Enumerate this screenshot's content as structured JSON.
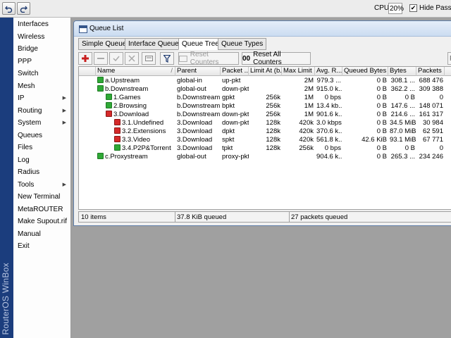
{
  "topbar": {
    "undo_icon": "undo-icon",
    "redo_icon": "redo-icon",
    "cpu_label": "CPU:",
    "cpu_value": "20%",
    "hide_passwords_checked": true,
    "hide_passwords_mark": "✔",
    "hide_passwords_label": "Hide Passwords"
  },
  "brand": {
    "text": "RouterOS WinBox"
  },
  "menu": {
    "items": [
      {
        "label": "Interfaces",
        "submenu": false
      },
      {
        "label": "Wireless",
        "submenu": false
      },
      {
        "label": "Bridge",
        "submenu": false
      },
      {
        "label": "PPP",
        "submenu": false
      },
      {
        "label": "Switch",
        "submenu": false
      },
      {
        "label": "Mesh",
        "submenu": false
      },
      {
        "label": "IP",
        "submenu": true
      },
      {
        "label": "Routing",
        "submenu": true
      },
      {
        "label": "System",
        "submenu": true
      },
      {
        "label": "Queues",
        "submenu": false
      },
      {
        "label": "Files",
        "submenu": false
      },
      {
        "label": "Log",
        "submenu": false
      },
      {
        "label": "Radius",
        "submenu": false
      },
      {
        "label": "Tools",
        "submenu": true
      },
      {
        "label": "New Terminal",
        "submenu": false
      },
      {
        "label": "MetaROUTER",
        "submenu": false
      },
      {
        "label": "Make Supout.rif",
        "submenu": false
      },
      {
        "label": "Manual",
        "submenu": false
      },
      {
        "label": "Exit",
        "submenu": false
      }
    ]
  },
  "window": {
    "title": "Queue List",
    "tabs": [
      {
        "label": "Simple Queues",
        "active": false
      },
      {
        "label": "Interface Queues",
        "active": false
      },
      {
        "label": "Queue Tree",
        "active": true
      },
      {
        "label": "Queue Types",
        "active": false
      }
    ],
    "toolbar": {
      "add_icon": "plus-icon",
      "remove_icon": "minus-icon",
      "enable_icon": "check-icon",
      "disable_icon": "cross-icon",
      "comment_icon": "comment-icon",
      "filter_icon": "filter-icon",
      "reset_counters": "Reset Counters",
      "reset_all_counters": "Reset All Counters",
      "reset_all_prefix": "00",
      "find_placeholder": "F"
    },
    "columns": [
      "Name",
      "Parent",
      "Packet ...",
      "Limit At (b...",
      "Max Limit ...",
      "Avg. R...",
      "Queued Bytes",
      "Bytes",
      "Packets"
    ],
    "name_sort_indicator": "/",
    "rows": [
      {
        "indent": 0,
        "icon": "green",
        "name": "a.Upstream",
        "parent": "global-in",
        "packet": "up-pkt",
        "limit_at": "",
        "max_limit": "2M",
        "avg": "979.3 ...",
        "queued": "0 B",
        "bytes": "308.1 ...",
        "packets": "688 476"
      },
      {
        "indent": 0,
        "icon": "green",
        "name": "b.Downstream",
        "parent": "global-out",
        "packet": "down-pkt",
        "limit_at": "",
        "max_limit": "2M",
        "avg": "915.0 k...",
        "queued": "0 B",
        "bytes": "362.2 ...",
        "packets": "309 388"
      },
      {
        "indent": 1,
        "icon": "green",
        "name": "1.Games",
        "parent": "b.Downstream",
        "packet": "gpkt",
        "limit_at": "256k",
        "max_limit": "1M",
        "avg": "0 bps",
        "queued": "0 B",
        "bytes": "0 B",
        "packets": "0"
      },
      {
        "indent": 1,
        "icon": "green",
        "name": "2.Browsing",
        "parent": "b.Downstream",
        "packet": "bpkt",
        "limit_at": "256k",
        "max_limit": "1M",
        "avg": "13.4 kb...",
        "queued": "0 B",
        "bytes": "147.6 ...",
        "packets": "148 071"
      },
      {
        "indent": 1,
        "icon": "red",
        "name": "3.Download",
        "parent": "b.Downstream",
        "packet": "down-pkt",
        "limit_at": "256k",
        "max_limit": "1M",
        "avg": "901.6 k...",
        "queued": "0 B",
        "bytes": "214.6 ...",
        "packets": "161 317"
      },
      {
        "indent": 2,
        "icon": "red",
        "name": "3.1.Undefined",
        "parent": "3.Download",
        "packet": "down-pkt",
        "limit_at": "128k",
        "max_limit": "420k",
        "avg": "3.0 kbps",
        "queued": "0 B",
        "bytes": "34.5 MiB",
        "packets": "30 984"
      },
      {
        "indent": 2,
        "icon": "red",
        "name": "3.2.Extensions",
        "parent": "3.Download",
        "packet": "dpkt",
        "limit_at": "128k",
        "max_limit": "420k",
        "avg": "370.6 k...",
        "queued": "0 B",
        "bytes": "87.0 MiB",
        "packets": "62 591"
      },
      {
        "indent": 2,
        "icon": "red",
        "name": "3.3.Video",
        "parent": "3.Download",
        "packet": "spkt",
        "limit_at": "128k",
        "max_limit": "420k",
        "avg": "561.8 k...",
        "queued": "42.6 KiB",
        "bytes": "93.1 MiB",
        "packets": "67 771"
      },
      {
        "indent": 2,
        "icon": "green",
        "name": "3.4.P2P&Torrent",
        "parent": "3.Download",
        "packet": "tpkt",
        "limit_at": "128k",
        "max_limit": "256k",
        "avg": "0 bps",
        "queued": "0 B",
        "bytes": "0 B",
        "packets": "0"
      },
      {
        "indent": 0,
        "icon": "green",
        "name": "c.Proxystream",
        "parent": "global-out",
        "packet": "proxy-pkt",
        "limit_at": "",
        "max_limit": "",
        "avg": "904.6 k...",
        "queued": "0 B",
        "bytes": "265.3 ...",
        "packets": "234 246"
      }
    ],
    "status": {
      "items": "10 items",
      "queued": "37.8 KiB queued",
      "packets_queued": "27 packets queued"
    }
  }
}
